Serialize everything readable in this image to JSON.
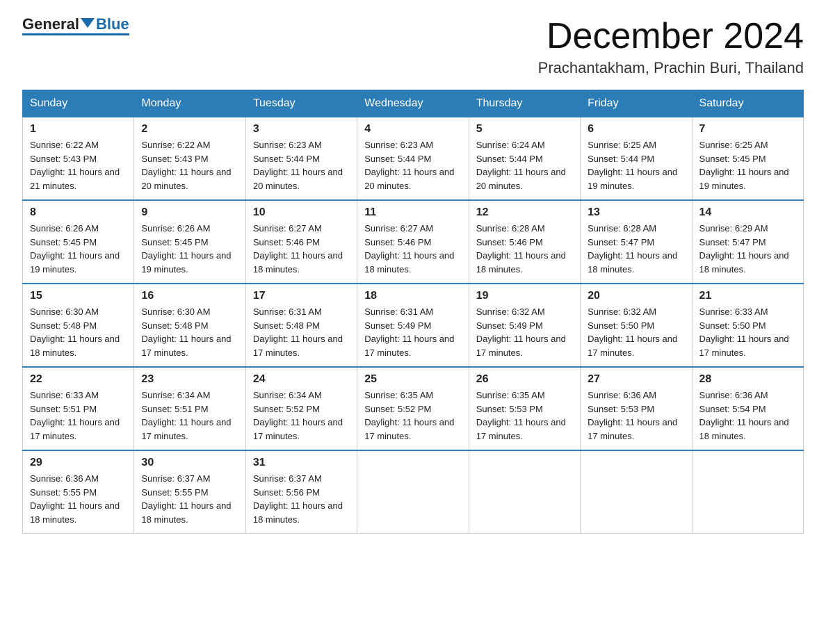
{
  "header": {
    "logo": {
      "general": "General",
      "blue": "Blue"
    },
    "title": "December 2024",
    "subtitle": "Prachantakham, Prachin Buri, Thailand"
  },
  "weekdays": [
    "Sunday",
    "Monday",
    "Tuesday",
    "Wednesday",
    "Thursday",
    "Friday",
    "Saturday"
  ],
  "weeks": [
    [
      {
        "day": "1",
        "sunrise": "6:22 AM",
        "sunset": "5:43 PM",
        "daylight": "11 hours and 21 minutes."
      },
      {
        "day": "2",
        "sunrise": "6:22 AM",
        "sunset": "5:43 PM",
        "daylight": "11 hours and 20 minutes."
      },
      {
        "day": "3",
        "sunrise": "6:23 AM",
        "sunset": "5:44 PM",
        "daylight": "11 hours and 20 minutes."
      },
      {
        "day": "4",
        "sunrise": "6:23 AM",
        "sunset": "5:44 PM",
        "daylight": "11 hours and 20 minutes."
      },
      {
        "day": "5",
        "sunrise": "6:24 AM",
        "sunset": "5:44 PM",
        "daylight": "11 hours and 20 minutes."
      },
      {
        "day": "6",
        "sunrise": "6:25 AM",
        "sunset": "5:44 PM",
        "daylight": "11 hours and 19 minutes."
      },
      {
        "day": "7",
        "sunrise": "6:25 AM",
        "sunset": "5:45 PM",
        "daylight": "11 hours and 19 minutes."
      }
    ],
    [
      {
        "day": "8",
        "sunrise": "6:26 AM",
        "sunset": "5:45 PM",
        "daylight": "11 hours and 19 minutes."
      },
      {
        "day": "9",
        "sunrise": "6:26 AM",
        "sunset": "5:45 PM",
        "daylight": "11 hours and 19 minutes."
      },
      {
        "day": "10",
        "sunrise": "6:27 AM",
        "sunset": "5:46 PM",
        "daylight": "11 hours and 18 minutes."
      },
      {
        "day": "11",
        "sunrise": "6:27 AM",
        "sunset": "5:46 PM",
        "daylight": "11 hours and 18 minutes."
      },
      {
        "day": "12",
        "sunrise": "6:28 AM",
        "sunset": "5:46 PM",
        "daylight": "11 hours and 18 minutes."
      },
      {
        "day": "13",
        "sunrise": "6:28 AM",
        "sunset": "5:47 PM",
        "daylight": "11 hours and 18 minutes."
      },
      {
        "day": "14",
        "sunrise": "6:29 AM",
        "sunset": "5:47 PM",
        "daylight": "11 hours and 18 minutes."
      }
    ],
    [
      {
        "day": "15",
        "sunrise": "6:30 AM",
        "sunset": "5:48 PM",
        "daylight": "11 hours and 18 minutes."
      },
      {
        "day": "16",
        "sunrise": "6:30 AM",
        "sunset": "5:48 PM",
        "daylight": "11 hours and 17 minutes."
      },
      {
        "day": "17",
        "sunrise": "6:31 AM",
        "sunset": "5:48 PM",
        "daylight": "11 hours and 17 minutes."
      },
      {
        "day": "18",
        "sunrise": "6:31 AM",
        "sunset": "5:49 PM",
        "daylight": "11 hours and 17 minutes."
      },
      {
        "day": "19",
        "sunrise": "6:32 AM",
        "sunset": "5:49 PM",
        "daylight": "11 hours and 17 minutes."
      },
      {
        "day": "20",
        "sunrise": "6:32 AM",
        "sunset": "5:50 PM",
        "daylight": "11 hours and 17 minutes."
      },
      {
        "day": "21",
        "sunrise": "6:33 AM",
        "sunset": "5:50 PM",
        "daylight": "11 hours and 17 minutes."
      }
    ],
    [
      {
        "day": "22",
        "sunrise": "6:33 AM",
        "sunset": "5:51 PM",
        "daylight": "11 hours and 17 minutes."
      },
      {
        "day": "23",
        "sunrise": "6:34 AM",
        "sunset": "5:51 PM",
        "daylight": "11 hours and 17 minutes."
      },
      {
        "day": "24",
        "sunrise": "6:34 AM",
        "sunset": "5:52 PM",
        "daylight": "11 hours and 17 minutes."
      },
      {
        "day": "25",
        "sunrise": "6:35 AM",
        "sunset": "5:52 PM",
        "daylight": "11 hours and 17 minutes."
      },
      {
        "day": "26",
        "sunrise": "6:35 AM",
        "sunset": "5:53 PM",
        "daylight": "11 hours and 17 minutes."
      },
      {
        "day": "27",
        "sunrise": "6:36 AM",
        "sunset": "5:53 PM",
        "daylight": "11 hours and 17 minutes."
      },
      {
        "day": "28",
        "sunrise": "6:36 AM",
        "sunset": "5:54 PM",
        "daylight": "11 hours and 18 minutes."
      }
    ],
    [
      {
        "day": "29",
        "sunrise": "6:36 AM",
        "sunset": "5:55 PM",
        "daylight": "11 hours and 18 minutes."
      },
      {
        "day": "30",
        "sunrise": "6:37 AM",
        "sunset": "5:55 PM",
        "daylight": "11 hours and 18 minutes."
      },
      {
        "day": "31",
        "sunrise": "6:37 AM",
        "sunset": "5:56 PM",
        "daylight": "11 hours and 18 minutes."
      },
      null,
      null,
      null,
      null
    ]
  ]
}
